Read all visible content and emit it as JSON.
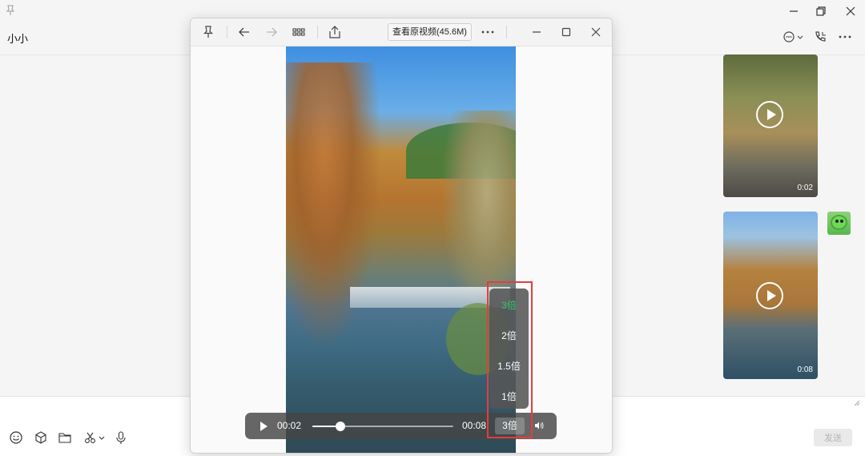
{
  "chat": {
    "title": "小小",
    "send_label": "发送",
    "videos": [
      {
        "duration": "0:02"
      },
      {
        "duration": "0:08"
      }
    ]
  },
  "viewer": {
    "original_button": "查看原视频(45.6M)",
    "controls": {
      "current_time": "00:02",
      "total_time": "00:08",
      "progress": 0.2,
      "speed_label": "3倍"
    },
    "speed_menu": {
      "options": [
        "3倍",
        "2倍",
        "1.5倍",
        "1倍"
      ],
      "selected": "3倍",
      "active_color": "#35c86b"
    }
  },
  "colors": {
    "highlight": "#e43d3d"
  }
}
